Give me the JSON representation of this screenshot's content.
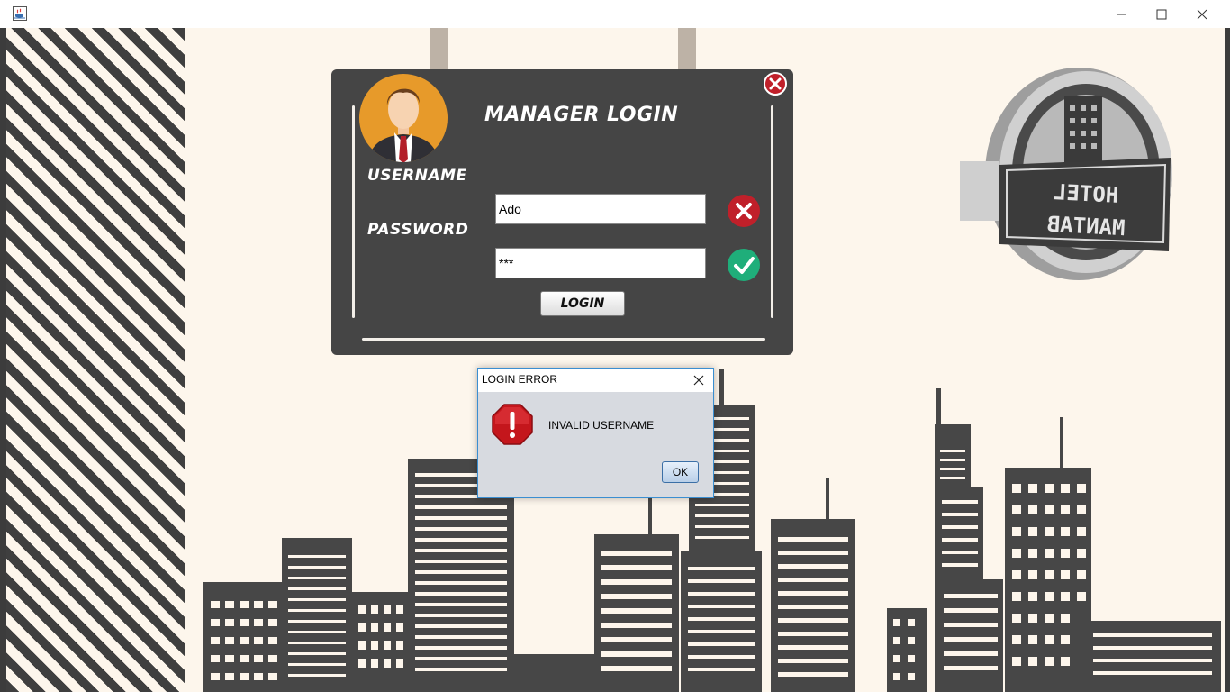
{
  "window": {
    "title": "",
    "controls": {
      "minimize": "minimize",
      "maximize": "maximize",
      "close": "close"
    }
  },
  "login_board": {
    "title": "MANAGER LOGIN",
    "username_label": "USERNAME",
    "password_label": "PASSWORD",
    "username_value": "Ado",
    "password_value": "***",
    "username_status": "invalid",
    "password_status": "valid",
    "login_button": "LOGIN"
  },
  "logo": {
    "line1": "HOTEL",
    "line2": "MANTAB"
  },
  "dialog": {
    "title": "LOGIN ERROR",
    "message": "INVALID USERNAME",
    "ok_button": "OK",
    "icon": "error-octagon-icon"
  },
  "colors": {
    "board_bg": "#454545",
    "page_bg": "#fdf6ec",
    "error_red": "#c0202a",
    "success_green": "#1fae7a"
  }
}
